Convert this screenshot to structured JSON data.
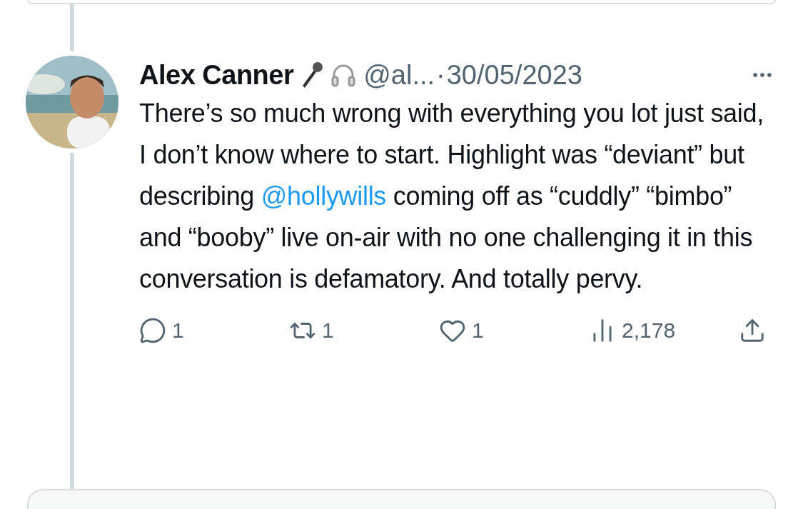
{
  "tweet": {
    "name": "Alex Canner",
    "handle": "@al...",
    "separator": "·",
    "date": "30/05/2023",
    "body": [
      {
        "kind": "text",
        "text": "There’s so much wrong with everything you lot just said, I don’t know where to start. Highlight was “deviant” but describing "
      },
      {
        "kind": "mention",
        "text": "@hollywills"
      },
      {
        "kind": "text",
        "text": " coming off as  “cuddly” “bimbo” and “booby” live on-air with no one challenging it in this conversation is defamatory. And totally pervy."
      }
    ],
    "actions": [
      {
        "kind": "reply",
        "count": "1"
      },
      {
        "kind": "retweet",
        "count": "1"
      },
      {
        "kind": "like",
        "count": "1"
      },
      {
        "kind": "views",
        "count": "2,178"
      },
      {
        "kind": "share"
      }
    ]
  }
}
